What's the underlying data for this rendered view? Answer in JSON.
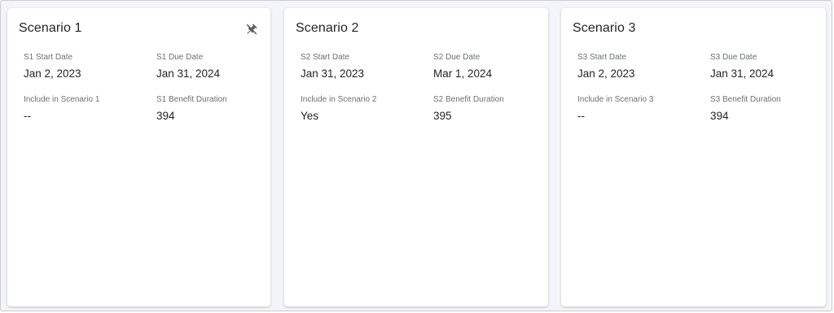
{
  "scenarios": [
    {
      "title": "Scenario 1",
      "start_label": "S1 Start Date",
      "start_value": "Jan 2, 2023",
      "due_label": "S1 Due Date",
      "due_value": "Jan 31, 2024",
      "include_label": "Include in Scenario 1",
      "include_value": "--",
      "duration_label": "S1 Benefit Duration",
      "duration_value": "394",
      "icon": "unpin-icon"
    },
    {
      "title": "Scenario 2",
      "start_label": "S2 Start Date",
      "start_value": "Jan 31, 2023",
      "due_label": "S2 Due Date",
      "due_value": "Mar 1, 2024",
      "include_label": "Include in Scenario 2",
      "include_value": "Yes",
      "duration_label": "S2 Benefit Duration",
      "duration_value": "395"
    },
    {
      "title": "Scenario 3",
      "start_label": "S3 Start Date",
      "start_value": "Jan 2, 2023",
      "due_label": "S3 Due Date",
      "due_value": "Jan 31, 2024",
      "include_label": "Include in Scenario 3",
      "include_value": "--",
      "duration_label": "S3 Benefit Duration",
      "duration_value": "394"
    }
  ],
  "colors": {
    "background": "#f4f5f8",
    "card": "#ffffff",
    "text": "#222428",
    "label": "#6b6f75",
    "icon": "#5f6368"
  }
}
